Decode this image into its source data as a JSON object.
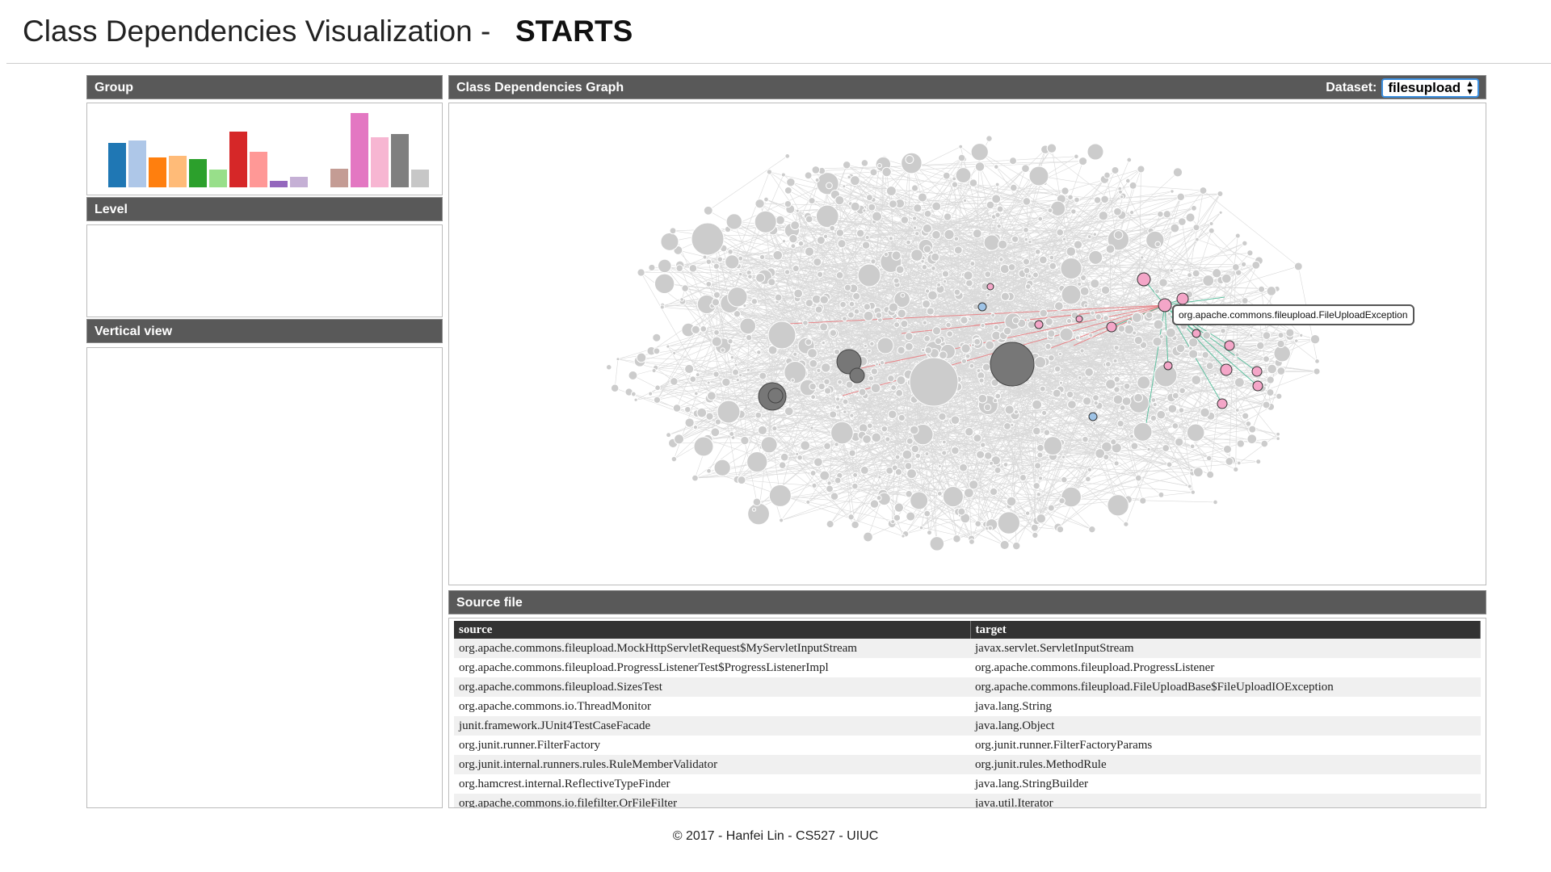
{
  "header": {
    "title": "Class Dependencies Visualization -",
    "title_strong": "STARTS"
  },
  "group_panel": {
    "title": "Group",
    "bars": [
      {
        "value": 0.58,
        "color": "#1f77b4"
      },
      {
        "value": 0.62,
        "color": "#aec7e8"
      },
      {
        "value": 0.39,
        "color": "#ff7f0e"
      },
      {
        "value": 0.42,
        "color": "#ffbb78"
      },
      {
        "value": 0.37,
        "color": "#2ca02c"
      },
      {
        "value": 0.23,
        "color": "#98df8a"
      },
      {
        "value": 0.73,
        "color": "#d62728"
      },
      {
        "value": 0.47,
        "color": "#ff9896"
      },
      {
        "value": 0.09,
        "color": "#9467bd"
      },
      {
        "value": 0.14,
        "color": "#c5b0d5"
      },
      {
        "value": 0.0,
        "color": "#ffffff"
      },
      {
        "value": 0.24,
        "color": "#c49c94"
      },
      {
        "value": 0.98,
        "color": "#e377c2"
      },
      {
        "value": 0.66,
        "color": "#f7b6d2"
      },
      {
        "value": 0.7,
        "color": "#7f7f7f"
      },
      {
        "value": 0.23,
        "color": "#c7c7c7"
      }
    ]
  },
  "level_panel": {
    "title": "Level"
  },
  "vertical_panel": {
    "title": "Vertical view"
  },
  "graph_panel": {
    "title": "Class Dependencies Graph",
    "dataset_label": "Dataset:",
    "dataset_value": "filesupload",
    "tooltip": "org.apache.commons.fileupload.FileUploadException",
    "colors": {
      "node": "#cccccc",
      "edge": "#d9d9d9",
      "highlight_pink": "#f4a6c8",
      "highlight_blue": "#9ec3e6",
      "dark_node": "#777777",
      "edge_in": "#e8868a",
      "edge_out": "#5fc0a0"
    }
  },
  "source_panel": {
    "title": "Source file",
    "columns": [
      "source",
      "target"
    ],
    "rows": [
      [
        "org.apache.commons.fileupload.MockHttpServletRequest$MyServletInputStream",
        "javax.servlet.ServletInputStream"
      ],
      [
        "org.apache.commons.fileupload.ProgressListenerTest$ProgressListenerImpl",
        "org.apache.commons.fileupload.ProgressListener"
      ],
      [
        "org.apache.commons.fileupload.SizesTest",
        "org.apache.commons.fileupload.FileUploadBase$FileUploadIOException"
      ],
      [
        "org.apache.commons.io.ThreadMonitor",
        "java.lang.String"
      ],
      [
        "junit.framework.JUnit4TestCaseFacade",
        "java.lang.Object"
      ],
      [
        "org.junit.runner.FilterFactory",
        "org.junit.runner.FilterFactoryParams"
      ],
      [
        "org.junit.internal.runners.rules.RuleMemberValidator",
        "org.junit.rules.MethodRule"
      ],
      [
        "org.hamcrest.internal.ReflectiveTypeFinder",
        "java.lang.StringBuilder"
      ],
      [
        "org.apache.commons.io.filefilter.OrFileFilter",
        "java.util.Iterator"
      ]
    ]
  },
  "footer": {
    "text": "© 2017 - Hanfei Lin - CS527 - UIUC"
  }
}
